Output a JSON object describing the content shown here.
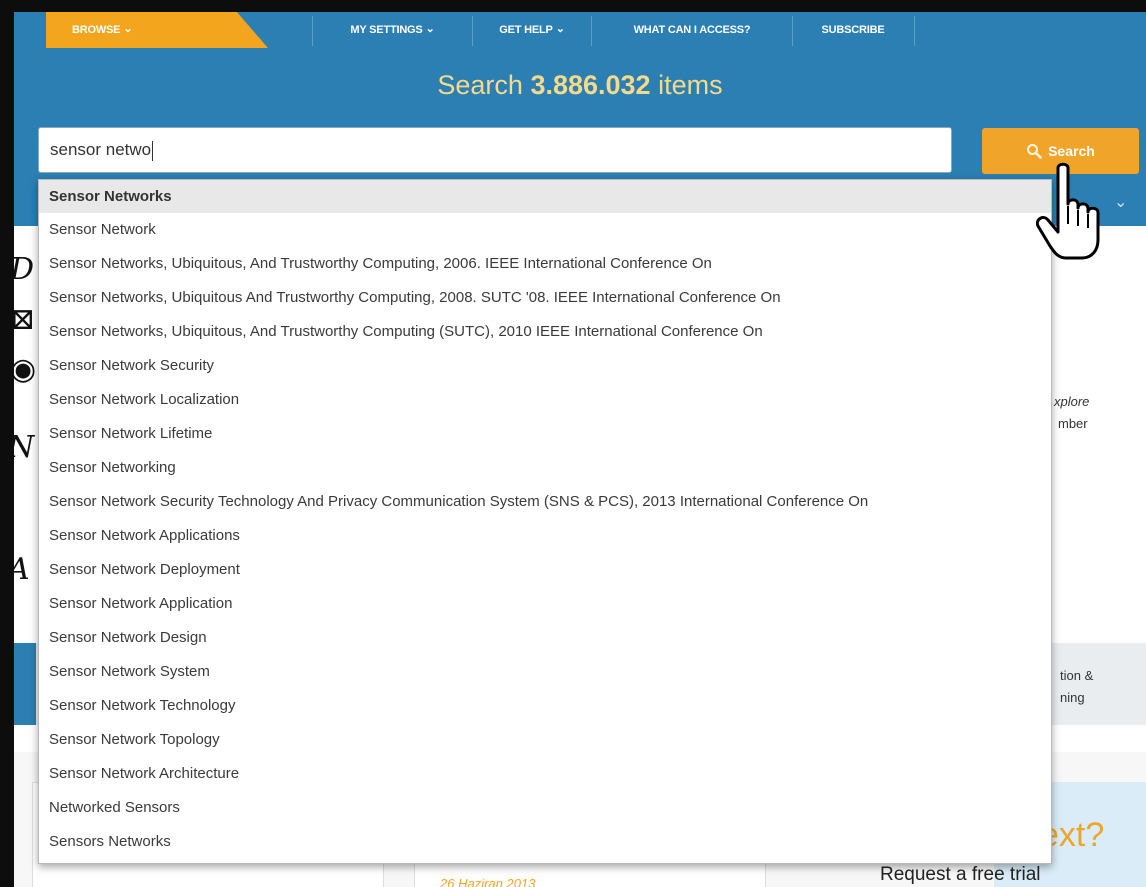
{
  "nav": {
    "browse": "BROWSE",
    "my_settings": "MY SETTINGS",
    "get_help": "GET HELP",
    "what_can_i_access": "WHAT CAN I ACCESS?",
    "subscribe": "SUBSCRIBE"
  },
  "headline": {
    "prefix": "Search",
    "count": "3.886.032",
    "suffix": "items"
  },
  "search": {
    "value": "sensor netwo",
    "button_label": "Search"
  },
  "suggestions": [
    "Sensor Networks",
    "Sensor Network",
    "Sensor Networks, Ubiquitous, And Trustworthy Computing, 2006. IEEE International Conference On",
    "Sensor Networks, Ubiquitous And Trustworthy Computing, 2008. SUTC '08. IEEE International Conference On",
    "Sensor Networks, Ubiquitous, And Trustworthy Computing (SUTC), 2010 IEEE International Conference On",
    "Sensor Network Security",
    "Sensor Network Localization",
    "Sensor Network Lifetime",
    "Sensor Networking",
    "Sensor Network Security Technology And Privacy Communication System (SNS & PCS), 2013 International Conference On",
    "Sensor Network Applications",
    "Sensor Network Deployment",
    "Sensor Network Application",
    "Sensor Network Design",
    "Sensor Network System",
    "Sensor Network Technology",
    "Sensor Network Topology",
    "Sensor Network Architecture",
    "Networked Sensors",
    "Sensors Networks"
  ],
  "background": {
    "xplore_fragment": "xplore",
    "mber_fragment": "mber",
    "tion_fragment": "tion &",
    "ning_fragment": "ning",
    "promo_heading": "ext?",
    "promo_sub": "Request a free trial",
    "date": "26 Haziran 2013"
  },
  "colors": {
    "header_blue": "#2b7fb2",
    "accent_orange": "#f0a42a",
    "headline_yellow": "#f6d98a"
  }
}
